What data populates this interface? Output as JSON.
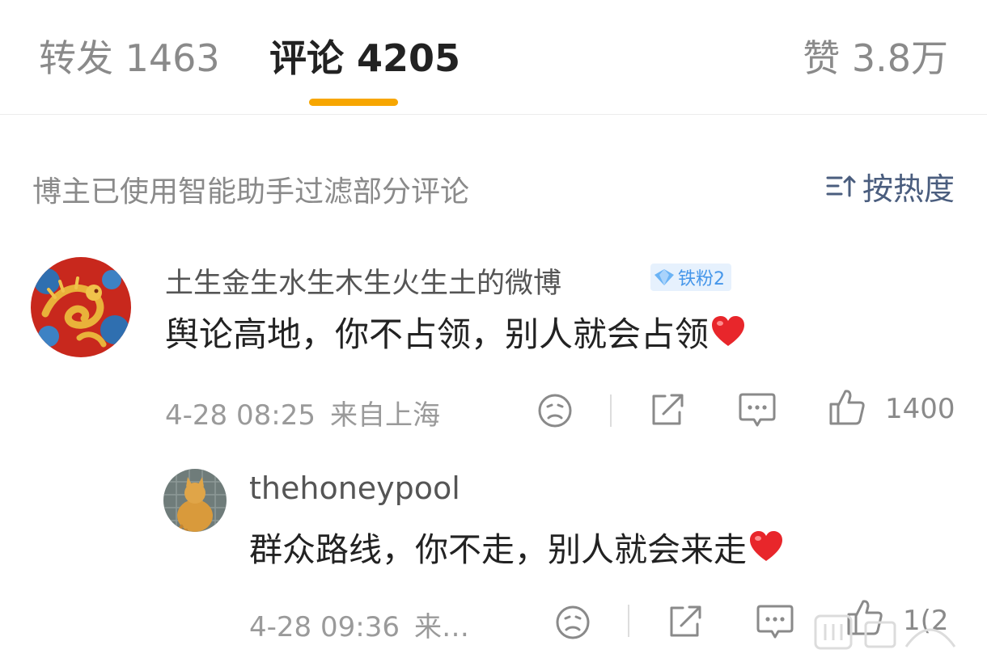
{
  "tabs": {
    "repost": "转发 1463",
    "comments": "评论 4205",
    "likes": "赞 3.8万"
  },
  "filter": {
    "note": "博主已使用智能助手过滤部分评论",
    "sort_label": "按热度"
  },
  "comments": [
    {
      "username": "土生金生水生木生火生土的微博",
      "badge": "铁粉2",
      "text": "舆论高地，你不占领，别人就会占领",
      "time": "4-28 08:25",
      "location": "来自上海",
      "like_count": "1400"
    },
    {
      "username": "thehoneypool",
      "text": "群众路线，你不走，别人就会来走",
      "time": "4-28 09:36",
      "location": "来…",
      "like_count": "1(2"
    }
  ],
  "colors": {
    "accent": "#f7a600",
    "sort": "#4a5d7e",
    "badge_bg": "#e6f1fd",
    "badge_text": "#4596ea",
    "heart": "#e8262b"
  },
  "icons": [
    "sort-icon",
    "diamond-icon",
    "heart-emoji-icon",
    "dislike-face-icon",
    "share-icon",
    "comment-icon",
    "thumbs-up-icon"
  ]
}
